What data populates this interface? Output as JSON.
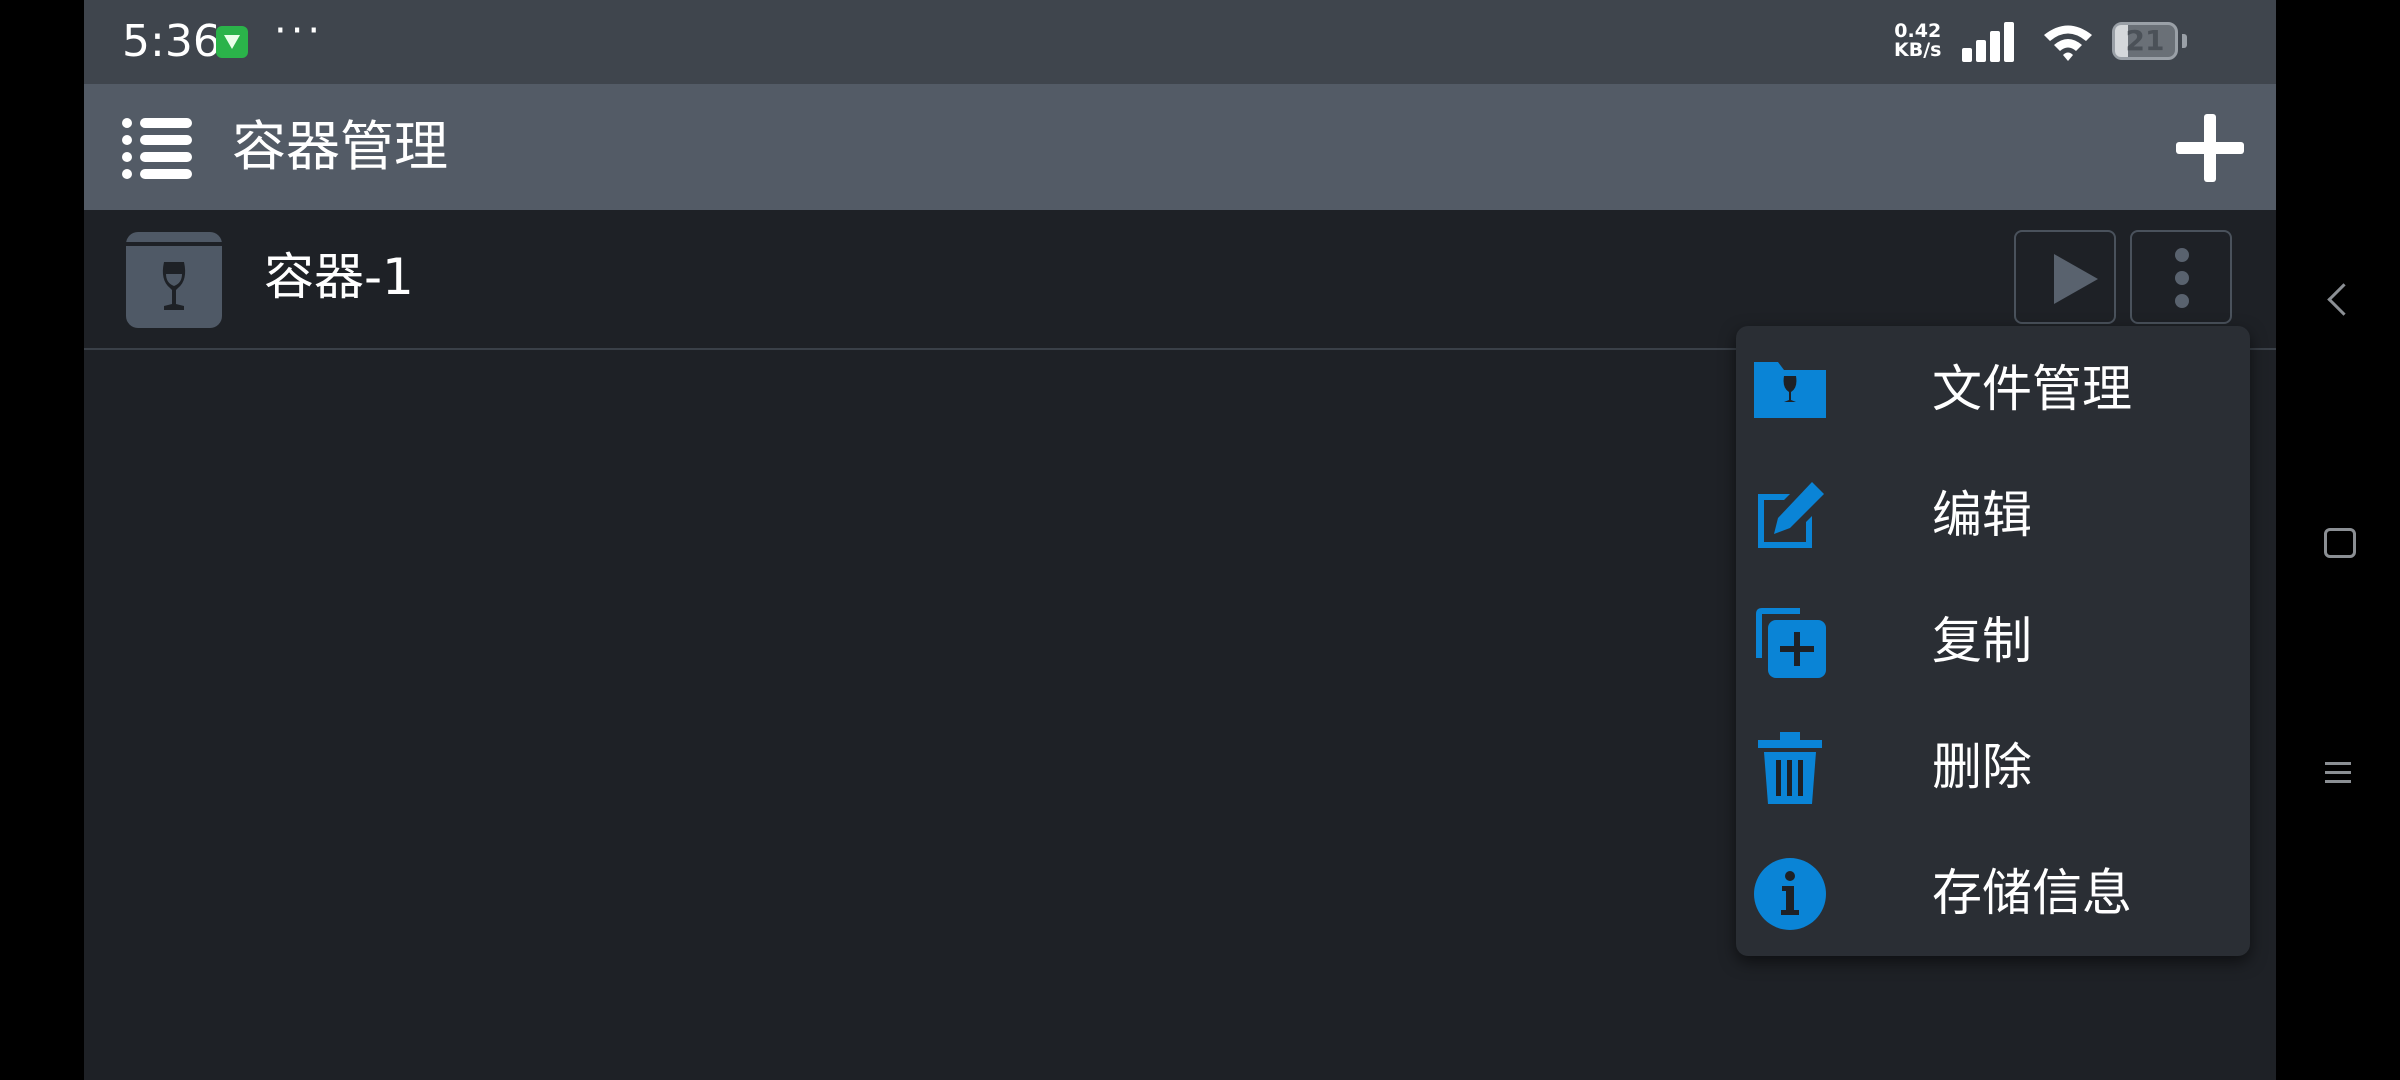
{
  "status_bar": {
    "time": "5:36",
    "more_indicator": "···",
    "net_speed_value": "0.42",
    "net_speed_unit": "KB/s",
    "battery_level": "21",
    "icons": [
      "app-notification-icon",
      "cellular-signal-icon",
      "wifi-icon",
      "battery-icon"
    ]
  },
  "app_bar": {
    "title": "容器管理",
    "menu_icon": "hamburger-menu-icon",
    "add_icon": "plus-icon"
  },
  "containers": [
    {
      "name": "容器-1",
      "icon": "wine-glass-icon"
    }
  ],
  "row_actions": {
    "run_icon": "play-icon",
    "more_icon": "more-vertical-icon"
  },
  "popup_menu": {
    "items": [
      {
        "label": "文件管理",
        "icon": "folder-icon"
      },
      {
        "label": "编辑",
        "icon": "edit-icon"
      },
      {
        "label": "复制",
        "icon": "duplicate-icon"
      },
      {
        "label": "删除",
        "icon": "trash-icon"
      },
      {
        "label": "存储信息",
        "icon": "info-icon"
      }
    ]
  },
  "nav_bar": {
    "icons": [
      "back-icon",
      "home-icon",
      "recent-apps-icon"
    ]
  },
  "colors": {
    "status_bar_bg": "#3f454d",
    "app_bar_bg": "#535b66",
    "content_bg": "#1e2126",
    "menu_bg": "#2a2e34",
    "accent": "#0a84d6"
  }
}
